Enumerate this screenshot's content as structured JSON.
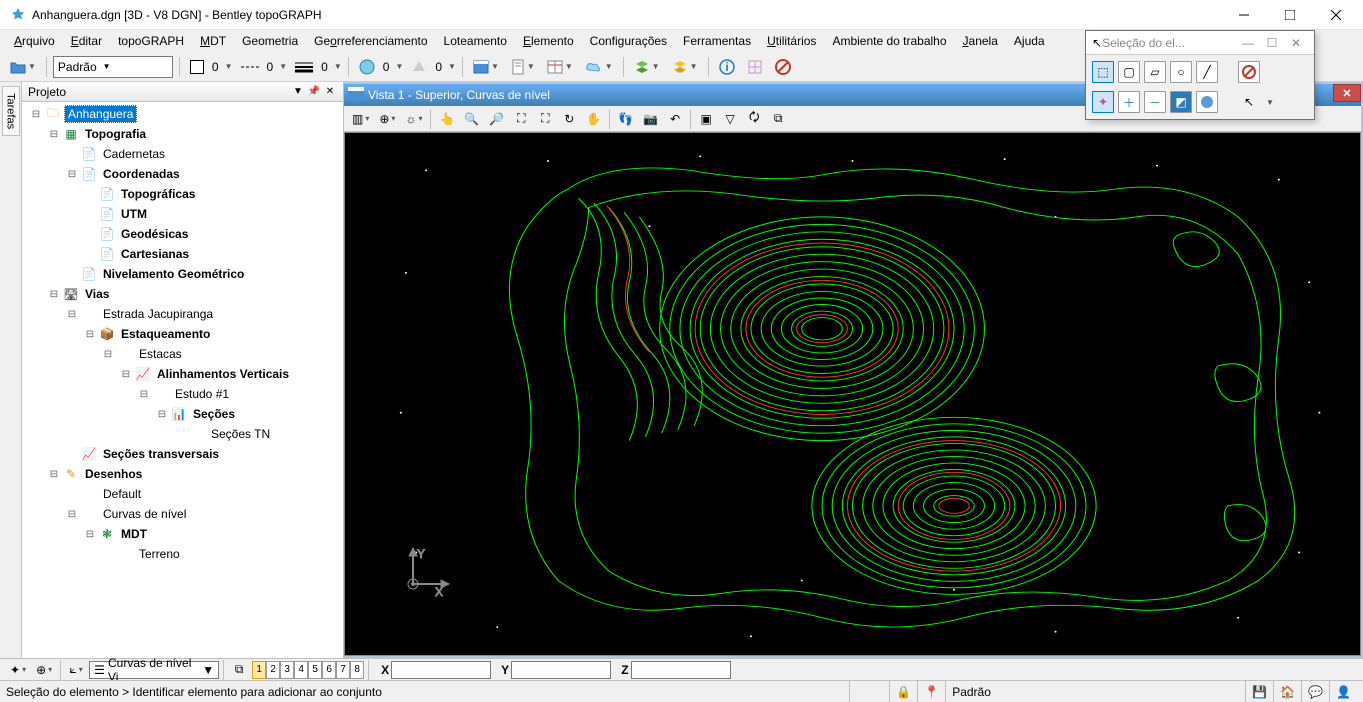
{
  "window": {
    "title": "Anhanguera.dgn [3D - V8 DGN] - Bentley topoGRAPH"
  },
  "menus": [
    "Arquivo",
    "Editar",
    "topoGRAPH",
    "MDT",
    "Geometria",
    "Georreferenciamento",
    "Loteamento",
    "Elemento",
    "Configurações",
    "Ferramentas",
    "Utilitários",
    "Ambiente do trabalho",
    "Janela",
    "Ajuda"
  ],
  "menu_underline_idx": [
    0,
    0,
    -1,
    0,
    -1,
    2,
    -1,
    0,
    -1,
    -1,
    0,
    -1,
    0,
    1
  ],
  "toolbar_values": {
    "fill": "0",
    "line": "0",
    "weight": "0",
    "level": "0",
    "other": "0"
  },
  "project_panel": {
    "title": "Projeto"
  },
  "tarefas_label": "Tarefas",
  "tree": [
    {
      "d": 0,
      "exp": "⊟",
      "icon": "🗀",
      "label": "Anhanguera",
      "sel": true,
      "bold": false,
      "iconcolor": "#f5a623"
    },
    {
      "d": 1,
      "exp": "⊟",
      "icon": "▦",
      "label": "Topografia",
      "bold": true,
      "iconcolor": "#1a7f37"
    },
    {
      "d": 2,
      "exp": "",
      "icon": "📄",
      "label": "Cadernetas",
      "iconcolor": "#d4a017"
    },
    {
      "d": 2,
      "exp": "⊟",
      "icon": "📄",
      "label": "Coordenadas",
      "bold": true,
      "iconcolor": "#2b7bb9"
    },
    {
      "d": 3,
      "exp": "",
      "icon": "📄",
      "label": "Topográficas",
      "bold": true,
      "iconcolor": "#d4a017"
    },
    {
      "d": 3,
      "exp": "",
      "icon": "📄",
      "label": "UTM",
      "bold": true,
      "iconcolor": "#2b7bb9"
    },
    {
      "d": 3,
      "exp": "",
      "icon": "📄",
      "label": "Geodésicas",
      "bold": true,
      "iconcolor": "#d4a017"
    },
    {
      "d": 3,
      "exp": "",
      "icon": "📄",
      "label": "Cartesianas",
      "bold": true,
      "iconcolor": "#d4a017"
    },
    {
      "d": 2,
      "exp": "",
      "icon": "📄",
      "label": "Nivelamento Geométrico",
      "bold": true,
      "iconcolor": "#d4a017"
    },
    {
      "d": 1,
      "exp": "⊟",
      "icon": "🛣",
      "label": "Vias",
      "bold": true,
      "iconcolor": "#555"
    },
    {
      "d": 2,
      "exp": "⊟",
      "icon": "",
      "label": "Estrada Jacupiranga"
    },
    {
      "d": 3,
      "exp": "⊟",
      "icon": "📦",
      "label": "Estaqueamento",
      "bold": true,
      "iconcolor": "#c79b4b"
    },
    {
      "d": 4,
      "exp": "⊟",
      "icon": "",
      "label": "Estacas"
    },
    {
      "d": 5,
      "exp": "⊟",
      "icon": "📈",
      "label": "Alinhamentos Verticais",
      "bold": true,
      "iconcolor": "#c0392b"
    },
    {
      "d": 6,
      "exp": "⊟",
      "icon": "",
      "label": "Estudo #1"
    },
    {
      "d": 7,
      "exp": "⊟",
      "icon": "📊",
      "label": "Seções",
      "bold": true,
      "iconcolor": "#c0392b"
    },
    {
      "d": 8,
      "exp": "",
      "icon": "",
      "label": "Seções TN"
    },
    {
      "d": 2,
      "exp": "",
      "icon": "📈",
      "label": "Seções transversais",
      "bold": true,
      "iconcolor": "#c0392b"
    },
    {
      "d": 1,
      "exp": "⊟",
      "icon": "✎",
      "label": "Desenhos",
      "bold": true,
      "iconcolor": "#d4a017"
    },
    {
      "d": 2,
      "exp": "",
      "icon": "",
      "label": "Default"
    },
    {
      "d": 2,
      "exp": "⊟",
      "icon": "",
      "label": "Curvas de nível"
    },
    {
      "d": 3,
      "exp": "⊟",
      "icon": "❃",
      "label": "MDT",
      "bold": true,
      "iconcolor": "#1a7f37"
    },
    {
      "d": 4,
      "exp": "",
      "icon": "",
      "label": "Terreno"
    }
  ],
  "view": {
    "title": "Vista 1 - Superior, Curvas de nível"
  },
  "tool_window": {
    "title": "Seleção do el..."
  },
  "bottom": {
    "level_combo": "Curvas de nível Vi",
    "level_combo_prefix": "☰",
    "numbers": [
      "1",
      "2",
      "3",
      "4",
      "5",
      "6",
      "7",
      "8"
    ],
    "active_num": "1",
    "coord_labels": {
      "x": "X",
      "y": "Y",
      "z": "Z"
    },
    "coord_values": {
      "x": "",
      "y": "",
      "z": ""
    },
    "combo_padrao": "Padrão"
  },
  "status": {
    "message": "Seleção do elemento > Identificar elemento para adicionar ao conjunto",
    "right_label": "Padrão"
  },
  "colors": {
    "accent": "#0078d4",
    "contour_green": "#00ff00",
    "contour_red": "#ff2020"
  }
}
